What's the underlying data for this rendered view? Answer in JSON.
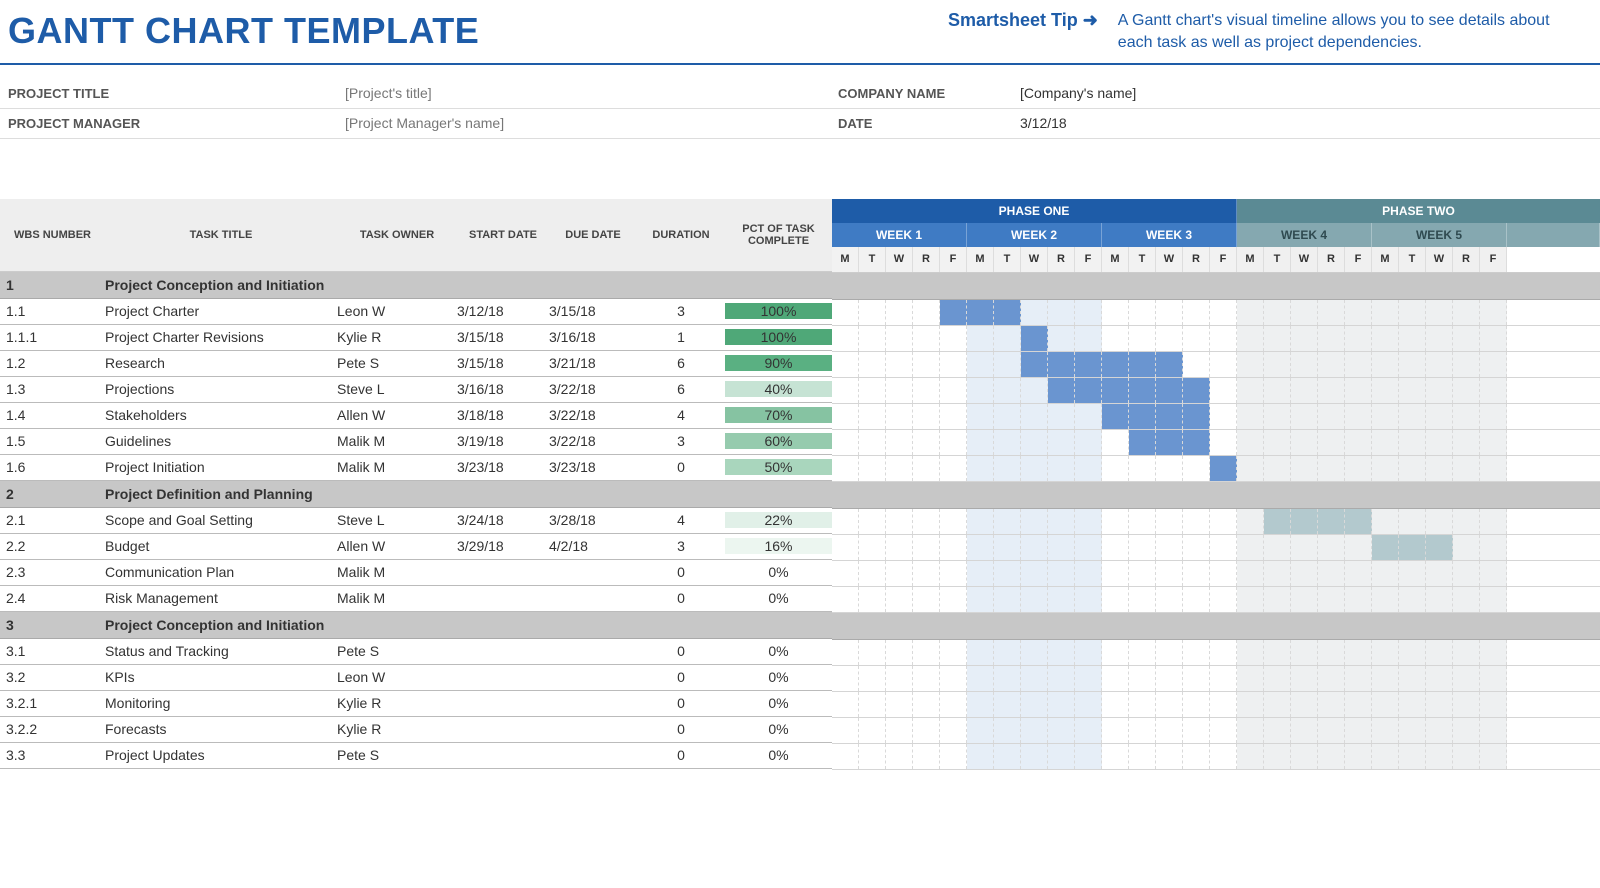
{
  "header": {
    "title": "GANTT CHART TEMPLATE",
    "tipLink": "Smartsheet Tip ➜",
    "tipText": "A Gantt chart's visual timeline allows you to see details about each task as well as project dependencies."
  },
  "meta": {
    "left": [
      {
        "label": "PROJECT TITLE",
        "value": "[Project's title]"
      },
      {
        "label": "PROJECT MANAGER",
        "value": "[Project Manager's name]"
      }
    ],
    "right": [
      {
        "label": "COMPANY NAME",
        "value": "[Company's name]"
      },
      {
        "label": "DATE",
        "value": "3/12/18"
      }
    ]
  },
  "columns": {
    "wbs": "WBS NUMBER",
    "title": "TASK TITLE",
    "owner": "TASK OWNER",
    "start": "START DATE",
    "due": "DUE DATE",
    "duration": "DURATION",
    "pct": "PCT OF TASK COMPLETE"
  },
  "phases": [
    {
      "name": "PHASE ONE",
      "weeks": [
        "WEEK 1",
        "WEEK 2",
        "WEEK 3"
      ]
    },
    {
      "name": "PHASE TWO",
      "weeks": [
        "WEEK 4",
        "WEEK 5"
      ]
    }
  ],
  "days": [
    "M",
    "T",
    "W",
    "R",
    "F"
  ],
  "chart_data": {
    "type": "gantt",
    "title": "GANTT CHART TEMPLATE",
    "timeline": {
      "phases": [
        "PHASE ONE",
        "PHASE TWO"
      ],
      "weeks": [
        "WEEK 1",
        "WEEK 2",
        "WEEK 3",
        "WEEK 4",
        "WEEK 5"
      ],
      "days_per_week": [
        "M",
        "T",
        "W",
        "R",
        "F"
      ]
    },
    "sections": [
      {
        "wbs": "1",
        "title": "Project Conception and Initiation",
        "tasks": [
          {
            "wbs": "1.1",
            "title": "Project Charter",
            "owner": "Leon W",
            "start": "3/12/18",
            "due": "3/15/18",
            "duration": 3,
            "pct": 100,
            "barStart": 4,
            "barEnd": 7
          },
          {
            "wbs": "1.1.1",
            "title": "Project Charter Revisions",
            "owner": "Kylie R",
            "start": "3/15/18",
            "due": "3/16/18",
            "duration": 1,
            "pct": 100,
            "barStart": 7,
            "barEnd": 8
          },
          {
            "wbs": "1.2",
            "title": "Research",
            "owner": "Pete S",
            "start": "3/15/18",
            "due": "3/21/18",
            "duration": 6,
            "pct": 90,
            "barStart": 7,
            "barEnd": 13
          },
          {
            "wbs": "1.3",
            "title": "Projections",
            "owner": "Steve L",
            "start": "3/16/18",
            "due": "3/22/18",
            "duration": 6,
            "pct": 40,
            "barStart": 8,
            "barEnd": 14
          },
          {
            "wbs": "1.4",
            "title": "Stakeholders",
            "owner": "Allen W",
            "start": "3/18/18",
            "due": "3/22/18",
            "duration": 4,
            "pct": 70,
            "barStart": 10,
            "barEnd": 14
          },
          {
            "wbs": "1.5",
            "title": "Guidelines",
            "owner": "Malik M",
            "start": "3/19/18",
            "due": "3/22/18",
            "duration": 3,
            "pct": 60,
            "barStart": 11,
            "barEnd": 14
          },
          {
            "wbs": "1.6",
            "title": "Project Initiation",
            "owner": "Malik M",
            "start": "3/23/18",
            "due": "3/23/18",
            "duration": 0,
            "pct": 50,
            "barStart": 14,
            "barEnd": 15
          }
        ]
      },
      {
        "wbs": "2",
        "title": "Project Definition and Planning",
        "tasks": [
          {
            "wbs": "2.1",
            "title": "Scope and Goal Setting",
            "owner": "Steve L",
            "start": "3/24/18",
            "due": "3/28/18",
            "duration": 4,
            "pct": 22,
            "barStart": 16,
            "barEnd": 20,
            "phase": 2
          },
          {
            "wbs": "2.2",
            "title": "Budget",
            "owner": "Allen W",
            "start": "3/29/18",
            "due": "4/2/18",
            "duration": 3,
            "pct": 16,
            "barStart": 20,
            "barEnd": 23,
            "phase": 2
          },
          {
            "wbs": "2.3",
            "title": "Communication Plan",
            "owner": "Malik M",
            "start": "",
            "due": "",
            "duration": 0,
            "pct": 0
          },
          {
            "wbs": "2.4",
            "title": "Risk Management",
            "owner": "Malik M",
            "start": "",
            "due": "",
            "duration": 0,
            "pct": 0
          }
        ]
      },
      {
        "wbs": "3",
        "title": "Project Conception and Initiation",
        "tasks": [
          {
            "wbs": "3.1",
            "title": "Status and Tracking",
            "owner": "Pete S",
            "start": "",
            "due": "",
            "duration": 0,
            "pct": 0
          },
          {
            "wbs": "3.2",
            "title": "KPIs",
            "owner": "Leon W",
            "start": "",
            "due": "",
            "duration": 0,
            "pct": 0
          },
          {
            "wbs": "3.2.1",
            "title": "Monitoring",
            "owner": "Kylie R",
            "start": "",
            "due": "",
            "duration": 0,
            "pct": 0
          },
          {
            "wbs": "3.2.2",
            "title": "Forecasts",
            "owner": "Kylie R",
            "start": "",
            "due": "",
            "duration": 0,
            "pct": 0
          },
          {
            "wbs": "3.3",
            "title": "Project Updates",
            "owner": "Pete S",
            "start": "",
            "due": "",
            "duration": 0,
            "pct": 0
          }
        ]
      }
    ]
  }
}
